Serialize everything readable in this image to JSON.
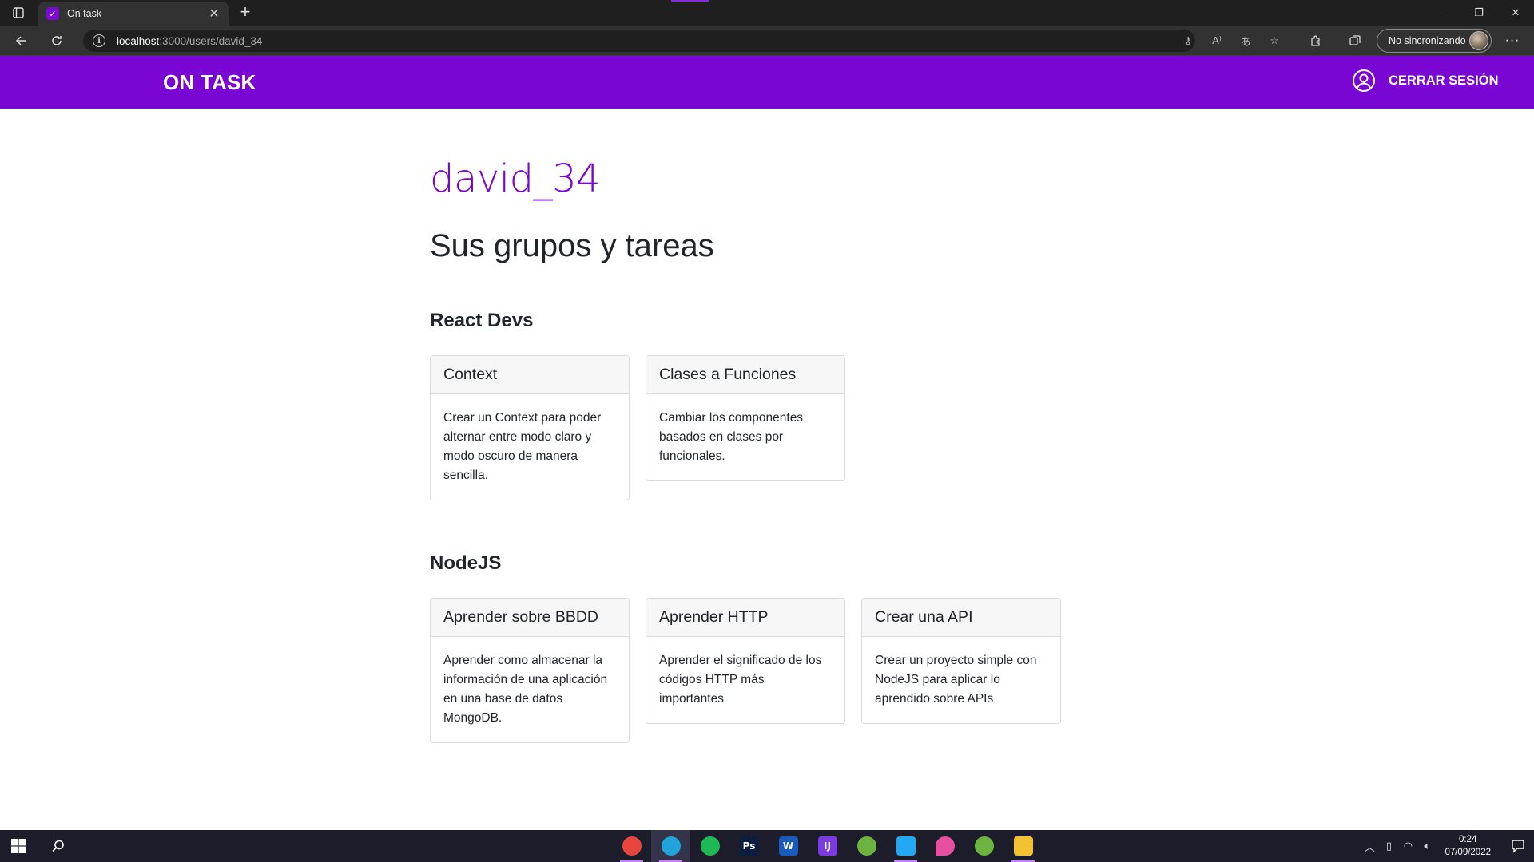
{
  "browser": {
    "tab": {
      "title": "On task"
    },
    "address": {
      "host": "localhost",
      "path": ":3000/users/david_34"
    },
    "sync_label": "No sincronizando"
  },
  "app": {
    "brand": "ON TASK",
    "logout_label": "CERRAR SESIÓN",
    "accent_color": "#7a06d4"
  },
  "profile": {
    "username": "david_34",
    "heading": "Sus grupos y tareas"
  },
  "groups": [
    {
      "name": "React Devs",
      "tasks": [
        {
          "title": "Context",
          "description": "Crear un Context para poder alternar entre modo claro y modo oscuro de manera sencilla."
        },
        {
          "title": "Clases a Funciones",
          "description": "Cambiar los componentes basados en clases por funcionales."
        }
      ]
    },
    {
      "name": "NodeJS",
      "tasks": [
        {
          "title": "Aprender sobre BBDD",
          "description": "Aprender como almacenar la información de una aplicación en una base de datos MongoDB."
        },
        {
          "title": "Aprender HTTP",
          "description": "Aprender el significado de los códigos HTTP más importantes"
        },
        {
          "title": "Crear una API",
          "description": "Crear un proyecto simple con NodeJS para aplicar lo aprendido sobre APIs"
        }
      ]
    }
  ],
  "taskbar": {
    "apps": [
      {
        "name": "chrome-icon",
        "color": "#e8453c"
      },
      {
        "name": "edge-icon",
        "color": "#1fa3d8"
      },
      {
        "name": "spotify-icon",
        "color": "#1db954"
      },
      {
        "name": "photoshop-icon",
        "color": "#0b1e3f"
      },
      {
        "name": "word-icon",
        "color": "#185abd"
      },
      {
        "name": "intellij-icon",
        "color": "#7a3ce0"
      },
      {
        "name": "spring-icon",
        "color": "#6db33f"
      },
      {
        "name": "vscode-icon",
        "color": "#23a9f2"
      },
      {
        "name": "paint-drop-icon",
        "color": "#e84fa0"
      },
      {
        "name": "spring-tool-icon",
        "color": "#6db33f"
      },
      {
        "name": "file-explorer-icon",
        "color": "#f2c230"
      }
    ],
    "time": "0:24",
    "date": "07/09/2022"
  }
}
